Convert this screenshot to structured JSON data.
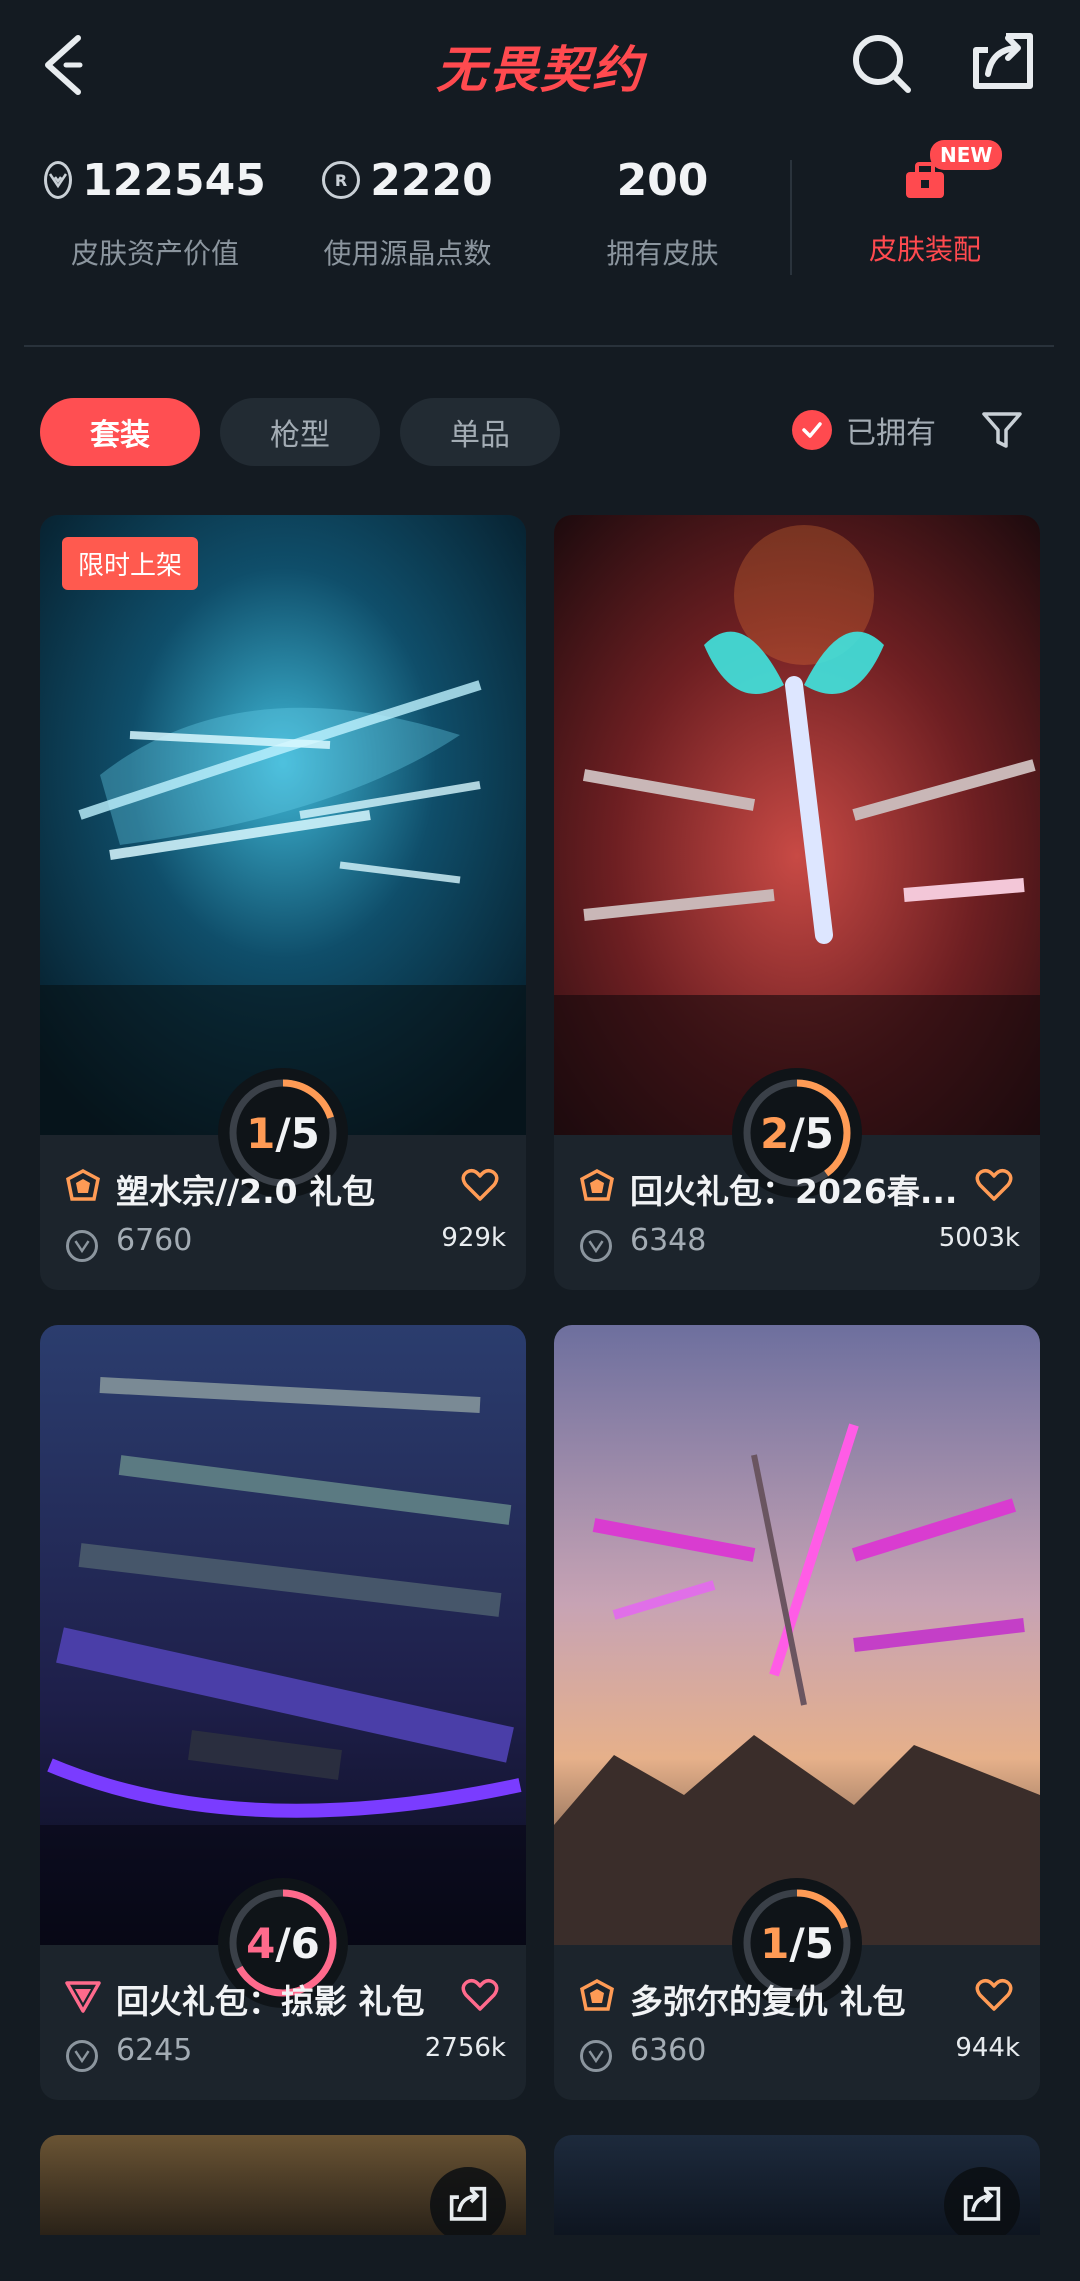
{
  "header": {
    "title": "无畏契约"
  },
  "stats": [
    {
      "value": "122545",
      "label": "皮肤资产价值",
      "icon": "vp-icon"
    },
    {
      "value": "2220",
      "label": "使用源晶点数",
      "icon": "radianite-icon"
    },
    {
      "value": "200",
      "label": "拥有皮肤",
      "icon": ""
    }
  ],
  "equip": {
    "label": "皮肤装配",
    "badge": "NEW"
  },
  "tabs": [
    "套装",
    "枪型",
    "单品"
  ],
  "owned_filter": {
    "label": "已拥有",
    "checked": true
  },
  "cards": [
    {
      "name": "塑水宗//2.0 礼包",
      "price": "6760",
      "likes": "929k",
      "progress_cur": "1",
      "progress_total": "5",
      "progress_fraction": 0.2,
      "badge": "限时上架",
      "tier": "deluxe",
      "accent": "#ff9b55"
    },
    {
      "name": "回火礼包：2026春...",
      "price": "6348",
      "likes": "5003k",
      "progress_cur": "2",
      "progress_total": "5",
      "progress_fraction": 0.4,
      "badge": "",
      "tier": "deluxe",
      "accent": "#ff9b55"
    },
    {
      "name": "回火礼包：掠影 礼包",
      "price": "6245",
      "likes": "2756k",
      "progress_cur": "4",
      "progress_total": "6",
      "progress_fraction": 0.667,
      "badge": "",
      "tier": "premium",
      "accent": "#ff6a8c"
    },
    {
      "name": "多弥尔的复仇 礼包",
      "price": "6360",
      "likes": "944k",
      "progress_cur": "1",
      "progress_total": "5",
      "progress_fraction": 0.2,
      "badge": "",
      "tier": "deluxe",
      "accent": "#ff9b55"
    }
  ],
  "colors": {
    "accent_red": "#ff4a4f",
    "bg": "#141b22",
    "card_bg": "#1c242c"
  }
}
